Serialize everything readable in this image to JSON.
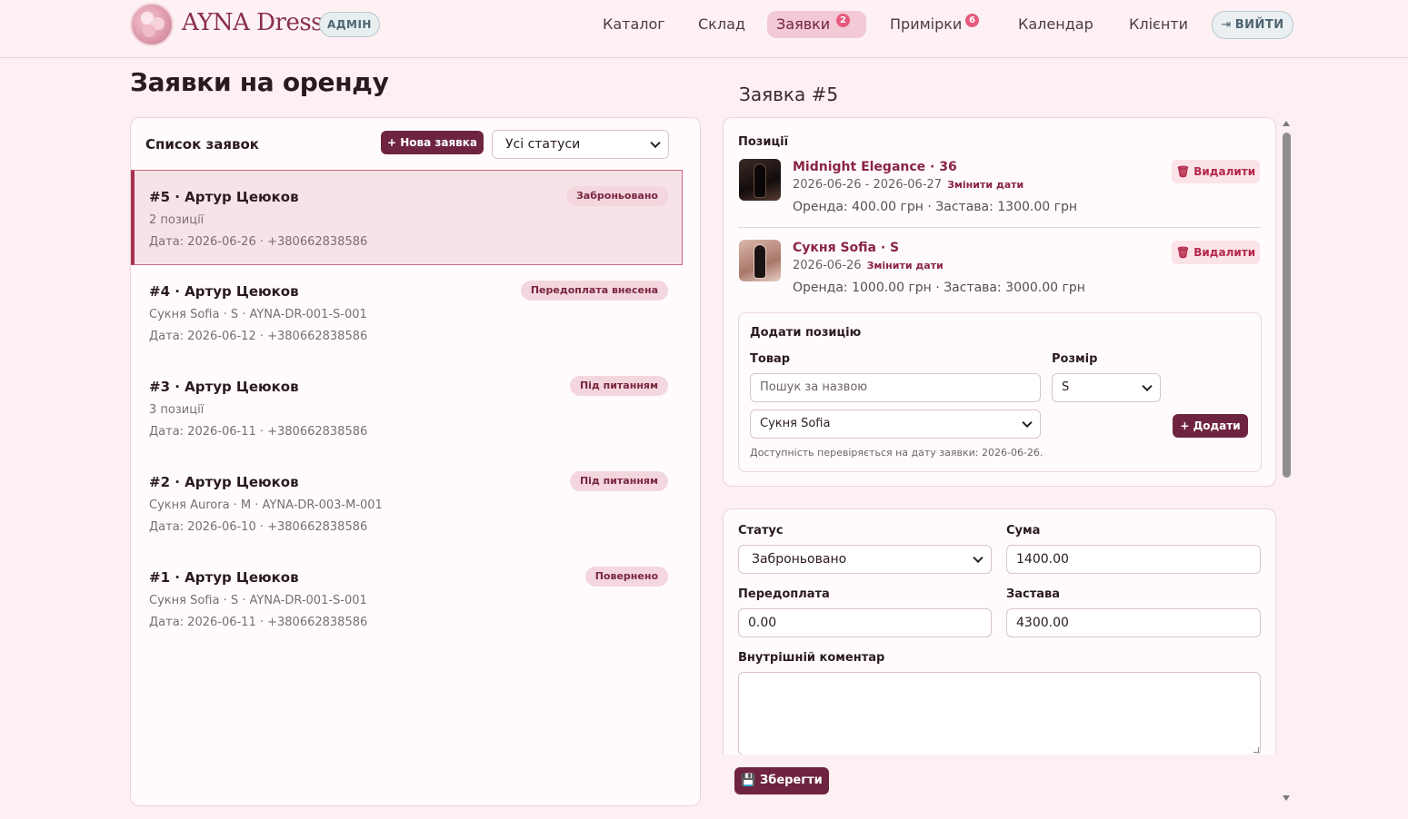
{
  "header": {
    "brand": "AYNA Dress",
    "role_badge": "АДМІН",
    "nav": [
      {
        "label": "Каталог"
      },
      {
        "label": "Склад"
      },
      {
        "label": "Заявки",
        "count": "2",
        "active": true
      },
      {
        "label": "Примірки",
        "count": "6"
      },
      {
        "label": "Календар"
      },
      {
        "label": "Клієнти"
      }
    ],
    "logout_label": "ВИЙТИ"
  },
  "page": {
    "title": "Заявки на оренду"
  },
  "list": {
    "title": "Список заявок",
    "new_button": "Нова заявка",
    "status_filter": "Усі статуси",
    "orders": [
      {
        "title": "#5 · Артур Цеюков",
        "sub": "2 позиції",
        "date": "Дата: 2026-06-26 · +380662838586",
        "status": "Заброньовано",
        "selected": true
      },
      {
        "title": "#4 · Артур Цеюков",
        "sub": "Сукня Sofia · S · AYNA-DR-001-S-001",
        "date": "Дата: 2026-06-12 · +380662838586",
        "status": "Передоплата внесена"
      },
      {
        "title": "#3 · Артур Цеюков",
        "sub": "3 позиції",
        "date": "Дата: 2026-06-11 · +380662838586",
        "status": "Під питанням"
      },
      {
        "title": "#2 · Артур Цеюков",
        "sub": "Сукня Aurora · M · AYNA-DR-003-M-001",
        "date": "Дата: 2026-06-10 · +380662838586",
        "status": "Під питанням"
      },
      {
        "title": "#1 · Артур Цеюков",
        "sub": "Сукня Sofia · S · AYNA-DR-001-S-001",
        "date": "Дата: 2026-06-11 · +380662838586",
        "status": "Повернено"
      }
    ]
  },
  "detail": {
    "title": "Заявка #5",
    "positions_label": "Позиції",
    "items": [
      {
        "name": "Midnight Elegance · 36",
        "dates": "2026-06-26 - 2026-06-27",
        "change_dates": "Змінити дати",
        "price": "Оренда: 400.00 грн · Застава: 1300.00 грн",
        "delete": "Видалити"
      },
      {
        "name": "Сукня Sofia · S",
        "dates": "2026-06-26",
        "change_dates": "Змінити дати",
        "price": "Оренда: 1000.00 грн · Застава: 3000.00 грн",
        "delete": "Видалити"
      }
    ],
    "add": {
      "title": "Додати позицію",
      "product_label": "Товар",
      "size_label": "Розмір",
      "search_placeholder": "Пошук за назвою",
      "size_value": "S",
      "product_value": "Сукня Sofia",
      "add_button": "Додати",
      "hint": "Доступність перевіряється на дату заявки: 2026-06-26."
    },
    "form": {
      "status_label": "Статус",
      "status_value": "Заброньовано",
      "sum_label": "Сума",
      "sum_value": "1400.00",
      "prepay_label": "Передоплата",
      "prepay_value": "0.00",
      "deposit_label": "Застава",
      "deposit_value": "4300.00",
      "comment_label": "Внутрішній коментар",
      "comment_value": ""
    },
    "save_button": "Зберегти"
  },
  "colors": {
    "accent": "#6e2440",
    "badge_bg": "#f4d7de",
    "page_bg": "#fdf0f3",
    "nav_count": "#e55a7d"
  }
}
